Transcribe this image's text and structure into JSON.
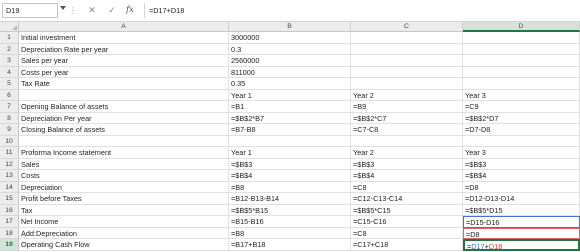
{
  "formula_bar": {
    "name_box": "D19",
    "separator": "⋮",
    "cancel_symbol": "✕",
    "enter_symbol": "✓",
    "fx_symbol": "fx",
    "formula": "=D17+D18"
  },
  "columns": [
    "A",
    "B",
    "C",
    "D"
  ],
  "selected_column": "D",
  "selected_row": 19,
  "rows": [
    {
      "num": "1",
      "A": "Initial investment",
      "B": "3000000",
      "C": "",
      "D": ""
    },
    {
      "num": "2",
      "A": "Depreciation Rate per year",
      "B": "0.3",
      "C": "",
      "D": ""
    },
    {
      "num": "3",
      "A": "Sales per year",
      "B": "2560000",
      "C": "",
      "D": ""
    },
    {
      "num": "4",
      "A": "Costs per year",
      "B": "811000",
      "C": "",
      "D": ""
    },
    {
      "num": "5",
      "A": "Tax Rate",
      "B": "0.35",
      "C": "",
      "D": ""
    },
    {
      "num": "6",
      "A": "",
      "B": "Year 1",
      "C": "Year 2",
      "D": "Year 3"
    },
    {
      "num": "7",
      "A": "Opening Balance of assets",
      "B": "=B1",
      "C": "=B9",
      "D": "=C9"
    },
    {
      "num": "8",
      "A": "Depreciation Per year",
      "B": "=$B$2*B7",
      "C": "=$B$2*C7",
      "D": "=$B$2*D7"
    },
    {
      "num": "9",
      "A": "Closing Balance of assets",
      "B": "=B7-B8",
      "C": "=C7-C8",
      "D": "=D7-D8"
    },
    {
      "num": "10",
      "A": "",
      "B": "",
      "C": "",
      "D": ""
    },
    {
      "num": "11",
      "A": "Proforma Income statement",
      "B": "Year 1",
      "C": "Year 2",
      "D": "Year 3"
    },
    {
      "num": "12",
      "A": "Sales",
      "B": "=$B$3",
      "C": "=$B$3",
      "D": "=$B$3"
    },
    {
      "num": "13",
      "A": "Costs",
      "B": "=$B$4",
      "C": "=$B$4",
      "D": "=$B$4"
    },
    {
      "num": "14",
      "A": "Depreciation",
      "B": "=B8",
      "C": "=C8",
      "D": "=D8"
    },
    {
      "num": "15",
      "A": "Profit before Taxes",
      "B": "=B12-B13-B14",
      "C": "=C12-C13-C14",
      "D": "=D12-D13-D14"
    },
    {
      "num": "16",
      "A": "Tax",
      "B": "=$B$5*B15",
      "C": "=$B$5*C15",
      "D": "=$B$5*D15"
    },
    {
      "num": "17",
      "A": "Net Income",
      "B": "=B15-B16",
      "C": "=C15-C16",
      "D": "=D15-D16"
    },
    {
      "num": "18",
      "A": "Add:Depreciation",
      "B": "=B8",
      "C": "=C8",
      "D": "=D8"
    },
    {
      "num": "19",
      "A": "Operating Cash Flow",
      "B": "=B17+B18",
      "C": "=C17+C18",
      "D_prefix": "=",
      "D_ref1": "D17",
      "D_op": "+",
      "D_ref2": "D18"
    }
  ],
  "colors": {
    "accent": "#217346",
    "ref_blue": "#4472c4",
    "ref_red": "#e06666"
  }
}
